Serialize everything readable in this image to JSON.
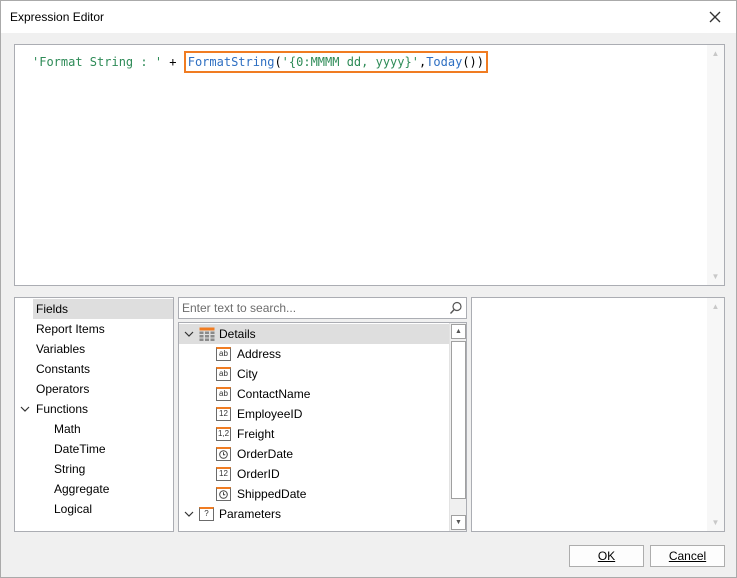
{
  "window": {
    "title": "Expression Editor",
    "close_icon": "close-icon"
  },
  "editor": {
    "tokens": {
      "str1": "'Format String : '",
      "plus": " + ",
      "fn1": "FormatString",
      "paren1": "(",
      "str2": "'{0:MMMM dd, yyyy}'",
      "comma": ",",
      "fn2": "Today",
      "paren2": "())"
    },
    "highlight_color": "#f07c22"
  },
  "categories": {
    "items": [
      {
        "label": "Fields",
        "selected": true
      },
      {
        "label": "Report Items"
      },
      {
        "label": "Variables"
      },
      {
        "label": "Constants"
      },
      {
        "label": "Operators"
      },
      {
        "label": "Functions",
        "expanded": true
      },
      {
        "label": "Math"
      },
      {
        "label": "DateTime"
      },
      {
        "label": "String"
      },
      {
        "label": "Aggregate"
      },
      {
        "label": "Logical"
      }
    ]
  },
  "search": {
    "placeholder": "Enter text to search...",
    "icon": "search-icon"
  },
  "tree": {
    "details_label": "Details",
    "fields": [
      {
        "label": "Address",
        "type_badge": "ab"
      },
      {
        "label": "City",
        "type_badge": "ab"
      },
      {
        "label": "ContactName",
        "type_badge": "ab"
      },
      {
        "label": "EmployeeID",
        "type_badge": "12"
      },
      {
        "label": "Freight",
        "type_badge": "1,2"
      },
      {
        "label": "OrderDate",
        "type_badge": "clock"
      },
      {
        "label": "OrderID",
        "type_badge": "12"
      },
      {
        "label": "ShippedDate",
        "type_badge": "clock"
      }
    ],
    "parameters_label": "Parameters",
    "parameters_badge": "?"
  },
  "buttons": {
    "ok_label": "OK",
    "cancel_label": "Cancel"
  },
  "colors": {
    "accent": "#f07c22",
    "string_token": "#2e8b57",
    "function_token": "#2e6fc2",
    "selection_bg": "#dedede"
  }
}
